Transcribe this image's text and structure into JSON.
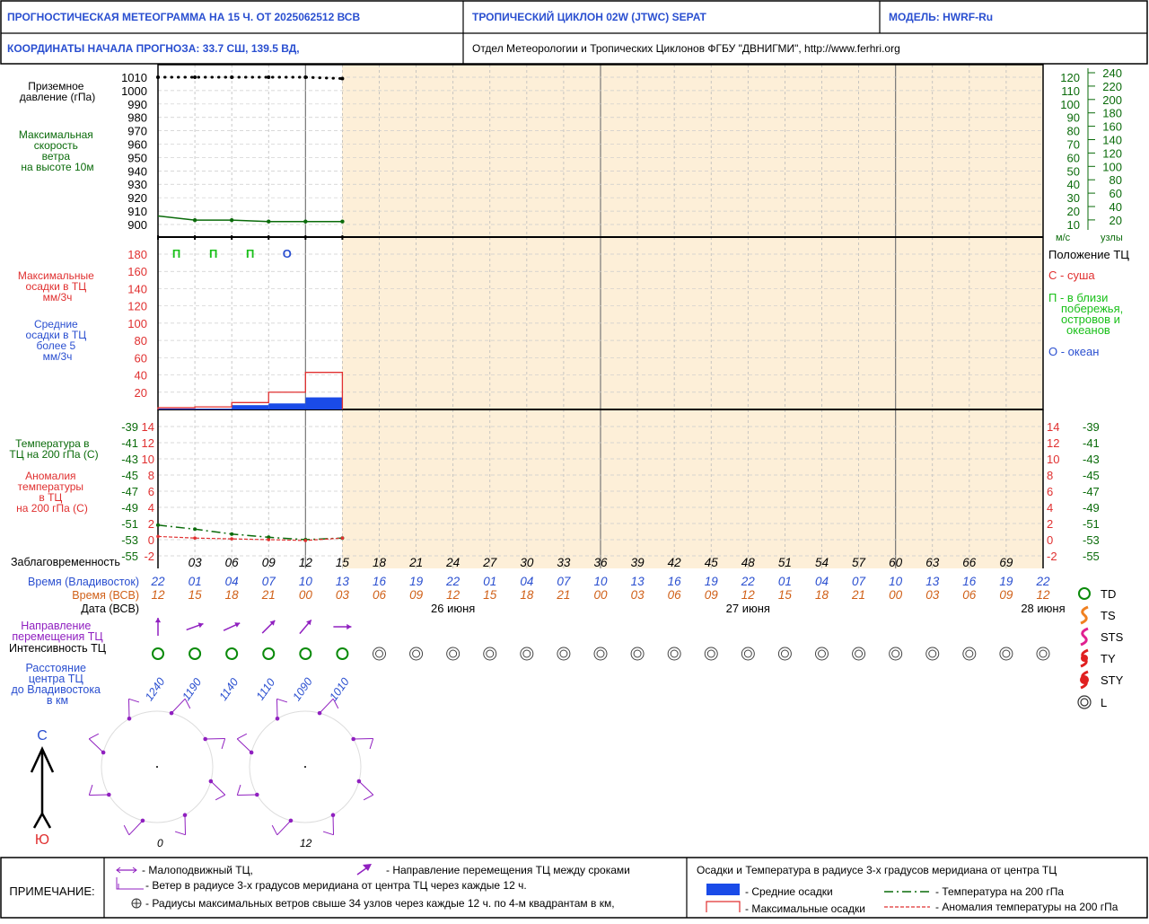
{
  "header": {
    "title": "ПРОГНОСТИЧЕСКАЯ МЕТЕОГРАММА НА 15 Ч. ОТ 2025062512 ВСВ",
    "cyclone": "ТРОПИЧЕСКИЙ ЦИКЛОН  02W  (JTWC)  SEPAT",
    "model": "МОДЕЛЬ:   HWRF-Ru",
    "coords": "КООРДИНАТЫ НАЧАЛА ПРОГНОЗА:  33.7  СШ,   139.5  ВД,",
    "org": "Отдел Метеорологии и Тропических Циклонов ФГБУ \"ДВНИГМИ\",  http://www.ferhri.org"
  },
  "panel1": {
    "label_pressure": [
      "Приземное",
      "давление (гПа)"
    ],
    "label_wind": [
      "Максимальная",
      "скорость",
      "ветра",
      "на высоте 10м"
    ],
    "pressure_ticks": [
      "1010",
      "1000",
      "990",
      "980",
      "970",
      "960",
      "950",
      "940",
      "930",
      "920",
      "910",
      "900"
    ],
    "wind_ms_ticks": [
      "120",
      "110",
      "100",
      "90",
      "80",
      "70",
      "60",
      "50",
      "40",
      "30",
      "20",
      "10"
    ],
    "wind_kt_ticks": [
      "240",
      "220",
      "200",
      "180",
      "160",
      "140",
      "120",
      "100",
      "80",
      "60",
      "40",
      "20"
    ],
    "unit_ms": "м/с",
    "unit_kt": "узлы"
  },
  "panel2": {
    "label_max": [
      "Максимальные",
      "осадки в ТЦ",
      "мм/3ч"
    ],
    "label_mean": [
      "Средние",
      "осадки в ТЦ",
      "более 5",
      "мм/3ч"
    ],
    "ticks": [
      "180",
      "160",
      "140",
      "120",
      "100",
      "80",
      "60",
      "40",
      "20"
    ],
    "position_codes": [
      "П",
      "П",
      "П",
      "О"
    ],
    "legend_title": "Положение ТЦ",
    "legend_land": "С - суша",
    "legend_coast": [
      "П - в близи",
      "побережья,",
      "островов и",
      "океанов"
    ],
    "legend_ocean": "О - океан"
  },
  "panel3": {
    "label_temp": [
      "Температура в",
      "ТЦ на 200 гПа (С)"
    ],
    "label_anom": [
      "Аномалия",
      "температуры",
      "в ТЦ",
      "на 200 гПа (С)"
    ],
    "temp_ticks": [
      "-39",
      "-41",
      "-43",
      "-45",
      "-47",
      "-49",
      "-51",
      "-53",
      "-55"
    ],
    "anom_ticks": [
      "14",
      "12",
      "10",
      "8",
      "6",
      "4",
      "2",
      "0",
      "-2"
    ]
  },
  "rows": {
    "lead_label": "Заблаговременность",
    "lead": [
      "03",
      "06",
      "09",
      "12",
      "15",
      "18",
      "21",
      "24",
      "27",
      "30",
      "33",
      "36",
      "39",
      "42",
      "45",
      "48",
      "51",
      "54",
      "57",
      "60",
      "63",
      "66",
      "69"
    ],
    "vlad_label": "Время (Владивосток)",
    "vlad": [
      "22",
      "01",
      "04",
      "07",
      "10",
      "13",
      "16",
      "19",
      "22",
      "01",
      "04",
      "07",
      "10",
      "13",
      "16",
      "19",
      "22",
      "01",
      "04",
      "07",
      "10",
      "13",
      "16",
      "19",
      "22"
    ],
    "utc_label": "Время (ВСВ)",
    "utc": [
      "12",
      "15",
      "18",
      "21",
      "00",
      "03",
      "06",
      "09",
      "12",
      "15",
      "18",
      "21",
      "00",
      "03",
      "06",
      "09",
      "12",
      "15",
      "18",
      "21",
      "00",
      "03",
      "06",
      "09",
      "12"
    ],
    "date_label": "Дата (ВСВ)",
    "dates": [
      "26 июня",
      "27 июня",
      "28 июня"
    ],
    "dir_label": [
      "Направление",
      "перемещения ТЦ"
    ],
    "int_label": "Интенсивность ТЦ",
    "dist_label": [
      "Расстояние",
      "центра ТЦ",
      "до Владивостока",
      "в км"
    ],
    "distances": [
      "1240",
      "1190",
      "1140",
      "1110",
      "1090",
      "1010"
    ]
  },
  "intensity_legend": [
    "TD",
    "TS",
    "STS",
    "TY",
    "STY",
    "L"
  ],
  "compass": {
    "north": "С",
    "south": "Ю"
  },
  "wind_rose_labels": [
    "0",
    "12"
  ],
  "footer": {
    "note": "ПРИМЕЧАНИЕ:",
    "item1": "- Малоподвижный ТЦ,",
    "item2": "- Направление перемещения ТЦ между сроками",
    "item3": "- Ветер в радиусе 3-х градусов меридиана от центра ТЦ через каждые 12 ч.",
    "item4": "- Радиусы максимальных ветров свыше 34 узлов через каждые 12 ч. по 4-м квадрантам в км,",
    "right_title": "Осадки и Температура в радиусе 3-х градусов меридиана от центра ТЦ",
    "leg_mean": "- Средние осадки",
    "leg_max": "- Максимальные осадки",
    "leg_temp": "- Температура на 200 гПа",
    "leg_anom": "- Аномалия температуры на 200 гПа"
  },
  "colors": {
    "forecast_bg": "#fdefd8",
    "blue": "#2a4fd0",
    "green": "#0a6b0a",
    "red": "#e03030",
    "purple": "#9020c0"
  },
  "chart_data": [
    {
      "type": "line",
      "title": "Приземное давление (гПа)",
      "x": [
        0,
        3,
        6,
        9,
        12,
        15
      ],
      "pressure": [
        1010,
        1010,
        1010,
        1010,
        1010,
        1009
      ],
      "ylim": [
        900,
        1010
      ]
    },
    {
      "type": "line",
      "title": "Максимальная скорость ветра на высоте 10м",
      "x": [
        0,
        3,
        6,
        9,
        12,
        15
      ],
      "wind_ms": [
        20,
        17,
        17,
        16,
        16,
        16
      ],
      "ylim": [
        10,
        120
      ]
    },
    {
      "type": "bar",
      "title": "Осадки в ТЦ мм/3ч",
      "x": [
        0,
        3,
        6,
        9,
        12
      ],
      "max_precip": [
        2,
        3,
        8,
        20,
        43
      ],
      "mean_precip": [
        1,
        1,
        5,
        7,
        14
      ],
      "ylim": [
        0,
        190
      ]
    },
    {
      "type": "line",
      "title": "Температура и аномалия на 200 гПа",
      "x": [
        0,
        3,
        6,
        9,
        12,
        15
      ],
      "temperature": [
        -51.2,
        -51.7,
        -52.3,
        -52.7,
        -53.0,
        -52.8
      ],
      "anomaly": [
        0.4,
        0.2,
        0.1,
        0.0,
        -0.1,
        0.2
      ],
      "temp_ylim": [
        -55,
        -39
      ],
      "anom_ylim": [
        -2,
        14
      ]
    }
  ]
}
